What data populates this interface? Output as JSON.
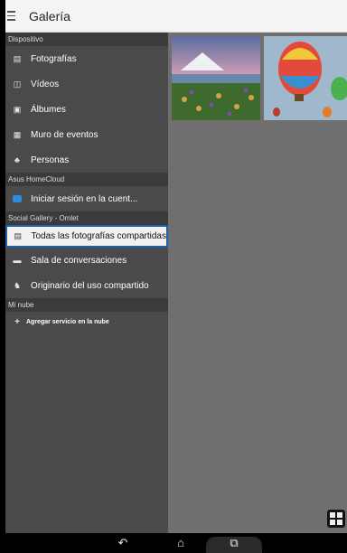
{
  "app": {
    "title": "Galería"
  },
  "drawer": {
    "sections": [
      {
        "header": "Dispositivo",
        "items": [
          {
            "label": "Fotografías",
            "icon": "photos-icon"
          },
          {
            "label": "Vídeos",
            "icon": "film-icon"
          },
          {
            "label": "Álbumes",
            "icon": "album-icon"
          },
          {
            "label": "Muro de eventos",
            "icon": "calendar-icon"
          },
          {
            "label": "Personas",
            "icon": "person-icon"
          }
        ]
      },
      {
        "header": "Asus HomeCloud",
        "items": [
          {
            "label": "Iniciar sesión en la cuent...",
            "icon": "cloud-icon"
          }
        ]
      },
      {
        "header": "Social Gallery - Omlet",
        "items": [
          {
            "label": "Todas las fotografías compartidas",
            "icon": "shared-photos-icon",
            "selected": true
          },
          {
            "label": "Sala de conversaciones",
            "icon": "chat-icon"
          },
          {
            "label": "Originario del uso compartido",
            "icon": "people-share-icon"
          }
        ]
      },
      {
        "header": "Mi nube",
        "items": [
          {
            "label": "Agregar servicio en la nube",
            "icon": "plus-icon"
          }
        ]
      }
    ]
  },
  "navbar": {
    "back": "back-icon",
    "home": "home-icon",
    "recents": "recents-icon"
  },
  "colors": {
    "selection_border": "#1f5fa8",
    "drawer_bg": "#4a4a4a",
    "section_bg": "#3b3b3b"
  }
}
